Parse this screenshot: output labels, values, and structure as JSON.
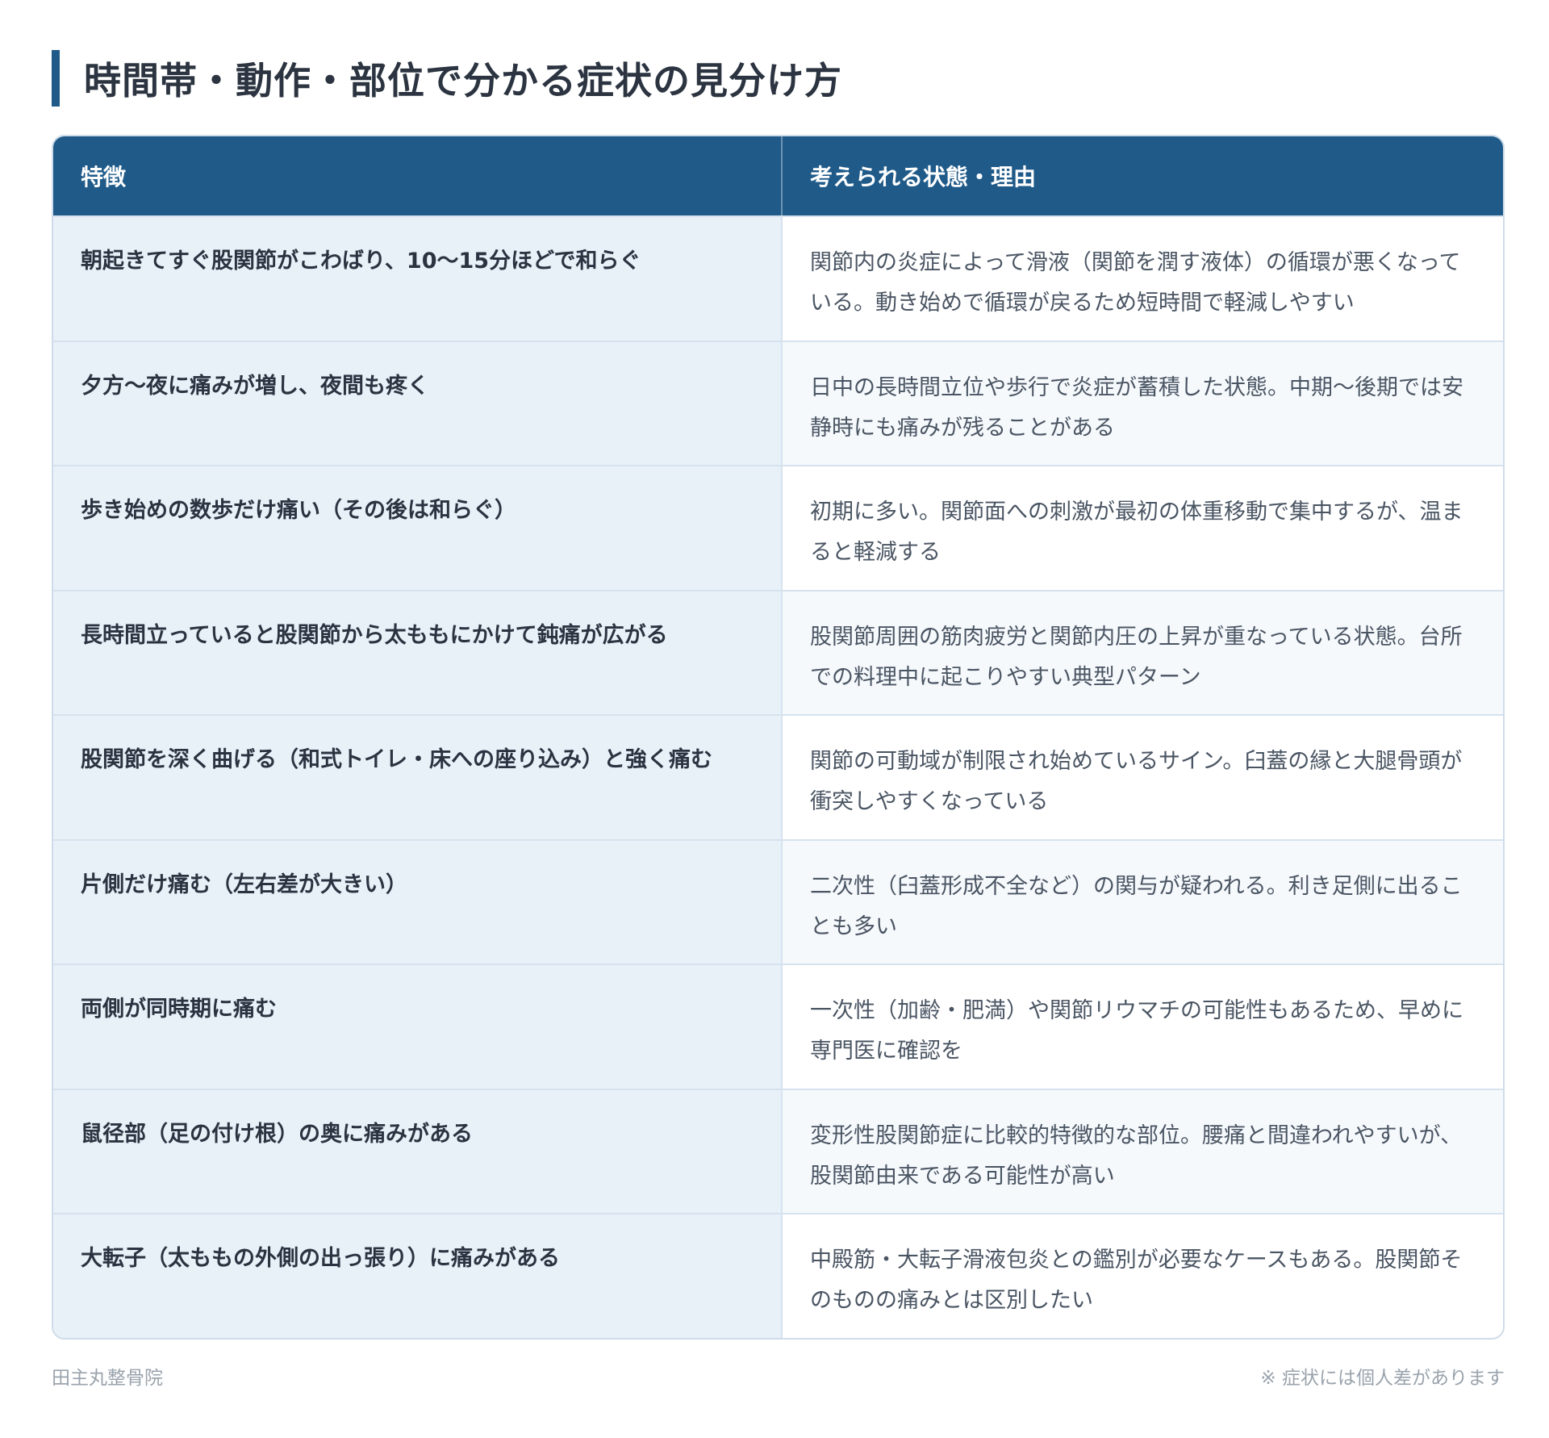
{
  "title": "時間帯・動作・部位で分かる症状の見分け方",
  "table": {
    "headers": [
      "特徴",
      "考えられる状態・理由"
    ],
    "rows": [
      {
        "feature": "朝起きてすぐ股関節がこわばり、10〜15分ほどで和らぐ",
        "reason": "関節内の炎症によって滑液（関節を潤す液体）の循環が悪くなっている。動き始めで循環が戻るため短時間で軽減しやすい"
      },
      {
        "feature": "夕方〜夜に痛みが増し、夜間も疼く",
        "reason": "日中の長時間立位や歩行で炎症が蓄積した状態。中期〜後期では安静時にも痛みが残ることがある"
      },
      {
        "feature": "歩き始めの数歩だけ痛い（その後は和らぐ）",
        "reason": "初期に多い。関節面への刺激が最初の体重移動で集中するが、温まると軽減する"
      },
      {
        "feature": "長時間立っていると股関節から太ももにかけて鈍痛が広がる",
        "reason": "股関節周囲の筋肉疲労と関節内圧の上昇が重なっている状態。台所での料理中に起こりやすい典型パターン"
      },
      {
        "feature": "股関節を深く曲げる（和式トイレ・床への座り込み）と強く痛む",
        "reason": "関節の可動域が制限され始めているサイン。臼蓋の縁と大腿骨頭が衝突しやすくなっている"
      },
      {
        "feature": "片側だけ痛む（左右差が大きい）",
        "reason": "二次性（臼蓋形成不全など）の関与が疑われる。利き足側に出ることも多い"
      },
      {
        "feature": "両側が同時期に痛む",
        "reason": "一次性（加齢・肥満）や関節リウマチの可能性もあるため、早めに専門医に確認を"
      },
      {
        "feature": "鼠径部（足の付け根）の奥に痛みがある",
        "reason": "変形性股関節症に比較的特徴的な部位。腰痛と間違われやすいが、股関節由来である可能性が高い"
      },
      {
        "feature": "大転子（太ももの外側の出っ張り）に痛みがある",
        "reason": "中殿筋・大転子滑液包炎との鑑別が必要なケースもある。股関節そのものの痛みとは区別したい"
      }
    ]
  },
  "footer": {
    "clinic_name": "田主丸整骨院",
    "note": "※ 症状には個人差があります"
  },
  "colors": {
    "header_bg": "#1f5a89",
    "feature_cell_bg": "#e8f0f8",
    "accent_bar": "#1f5a89"
  }
}
